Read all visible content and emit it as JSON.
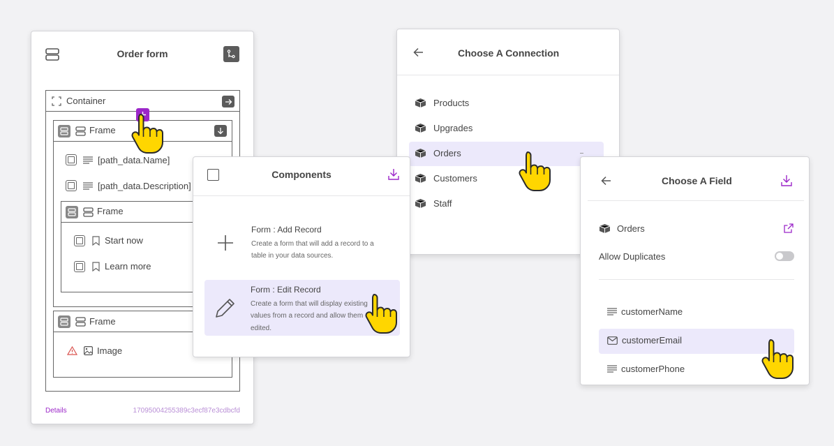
{
  "order_form": {
    "title": "Order form",
    "container_label": "Container",
    "frame1_label": "Frame",
    "field_name": "[path_data.Name]",
    "field_description": "[path_data.Description]",
    "frame2_label": "Frame",
    "start_now": "Start now",
    "learn_more": "Learn more",
    "frame3_label": "Frame",
    "image_label": "Image",
    "details_link": "Details",
    "id_text": "17095004255389c3ecf87e3cdbcfd"
  },
  "components": {
    "title": "Components",
    "add_record_title": "Form : Add Record",
    "add_record_desc_1": "Create a form that will add a record to a",
    "add_record_desc_2": "table in your data sources.",
    "edit_record_title": "Form : Edit Record",
    "edit_record_desc_1": "Create a form that will display existing",
    "edit_record_desc_2": "values from a record and allow them",
    "edit_record_desc_3": "edited."
  },
  "connection": {
    "title": "Choose A Connection",
    "items": [
      "Products",
      "Upgrades",
      "Orders",
      "Customers",
      "Staff"
    ],
    "selected": "Orders"
  },
  "field": {
    "title": "Choose A Field",
    "source": "Orders",
    "allow_duplicates_label": "Allow Duplicates",
    "allow_duplicates": false,
    "items": [
      "customerName",
      "customerEmail",
      "customerPhone"
    ],
    "selected": "customerEmail"
  },
  "colors": {
    "accent": "#9c27c9",
    "highlight": "#ece9fb",
    "warning": "#d9534f"
  }
}
